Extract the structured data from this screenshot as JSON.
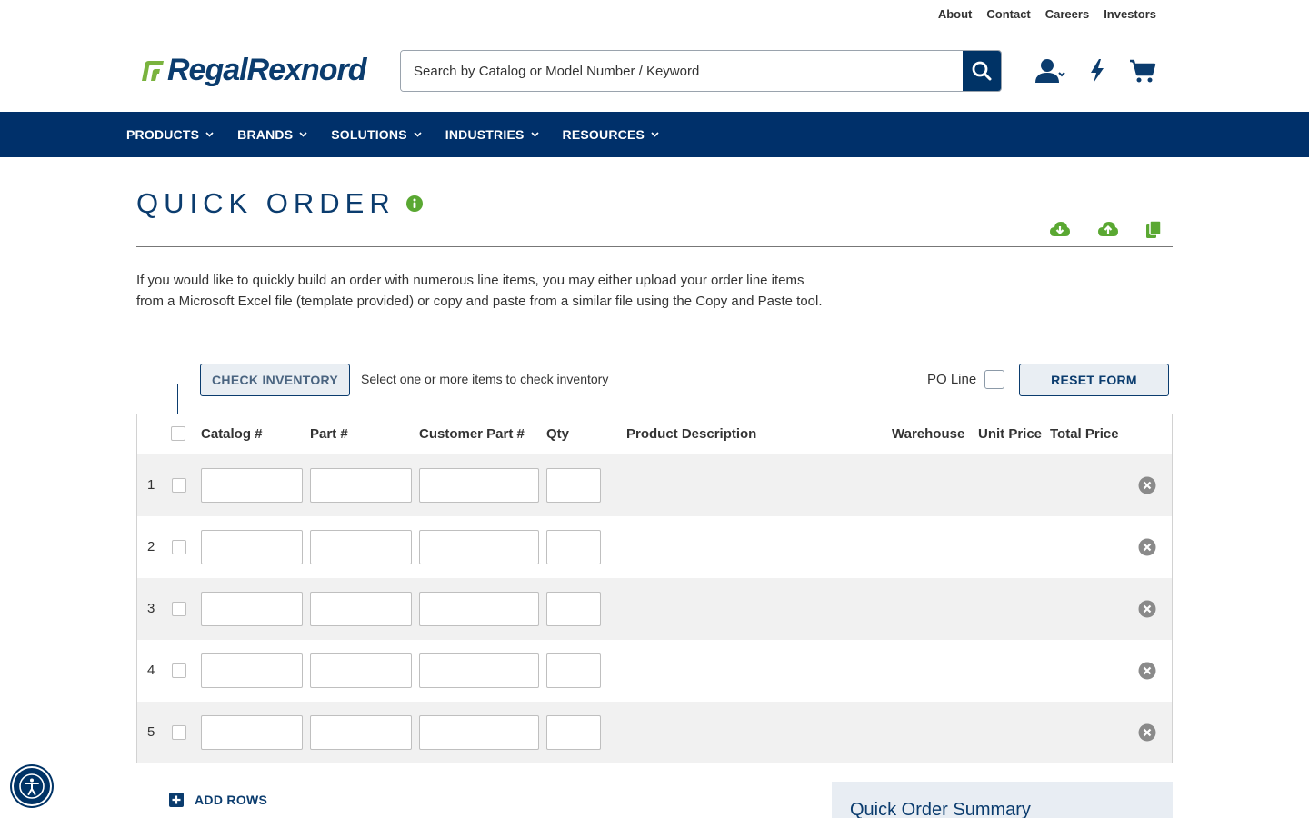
{
  "utility_nav": [
    "About",
    "Contact",
    "Careers",
    "Investors"
  ],
  "brand": {
    "logo_text": "RegalRexnord",
    "accent": "#7ab33e",
    "primary": "#00306a"
  },
  "search": {
    "placeholder": "Search by Catalog or Model Number / Keyword",
    "value": ""
  },
  "header_icons": [
    "user-account-icon",
    "quick-order-bolt-icon",
    "cart-icon"
  ],
  "main_nav": [
    "PRODUCTS",
    "BRANDS",
    "SOLUTIONS",
    "INDUSTRIES",
    "RESOURCES"
  ],
  "page": {
    "title": "QUICK ORDER",
    "intro": "If you would like to quickly build an order with numerous line items, you may either upload your order line items from a Microsoft Excel file (template provided) or copy and paste from a similar file using the Copy and Paste tool."
  },
  "tools": [
    "download-template-icon",
    "upload-file-icon",
    "copy-paste-icon"
  ],
  "actions": {
    "check_inventory_label": "CHECK INVENTORY",
    "check_inventory_help": "Select one or more items to check inventory",
    "po_line_label": "PO Line",
    "reset_label": "RESET FORM"
  },
  "table": {
    "columns": [
      "Catalog #",
      "Part #",
      "Customer Part #",
      "Qty",
      "Product Description",
      "Warehouse",
      "Unit Price",
      "Total Price"
    ],
    "rows": [
      {
        "num": "1",
        "catalog": "",
        "part": "",
        "customer_part": "",
        "qty": ""
      },
      {
        "num": "2",
        "catalog": "",
        "part": "",
        "customer_part": "",
        "qty": ""
      },
      {
        "num": "3",
        "catalog": "",
        "part": "",
        "customer_part": "",
        "qty": ""
      },
      {
        "num": "4",
        "catalog": "",
        "part": "",
        "customer_part": "",
        "qty": ""
      },
      {
        "num": "5",
        "catalog": "",
        "part": "",
        "customer_part": "",
        "qty": ""
      }
    ]
  },
  "add_rows_label": "ADD ROWS",
  "summary": {
    "title": "Quick Order Summary"
  }
}
